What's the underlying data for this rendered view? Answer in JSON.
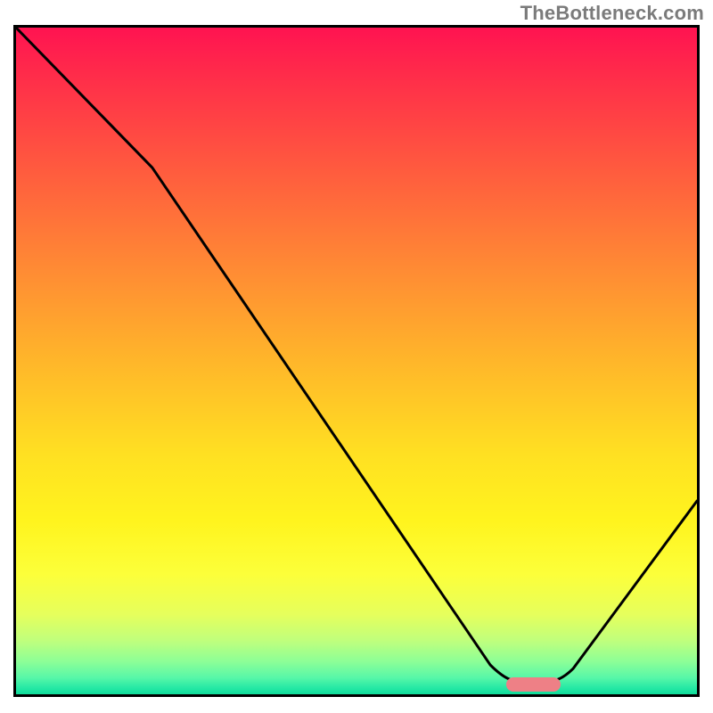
{
  "watermark": "TheBottleneck.com",
  "chart_data": {
    "type": "line",
    "title": "",
    "xlabel": "",
    "ylabel": "",
    "xlim": [
      0,
      100
    ],
    "ylim": [
      0,
      100
    ],
    "grid": false,
    "legend": false,
    "annotations": [],
    "background_gradient": {
      "direction": "vertical",
      "stops": [
        {
          "pos": 0,
          "color": "#ff1351"
        },
        {
          "pos": 50,
          "color": "#ffb62a"
        },
        {
          "pos": 82,
          "color": "#fcff3a"
        },
        {
          "pos": 100,
          "color": "#0fdc9a"
        }
      ]
    },
    "series": [
      {
        "name": "bottleneck-curve",
        "x": [
          0,
          20,
          72,
          80,
          100
        ],
        "y": [
          100,
          79,
          2,
          2,
          29
        ]
      }
    ],
    "marker": {
      "name": "optimal-range",
      "x_start": 72,
      "x_end": 80,
      "y": 1,
      "color": "#ee8086"
    }
  },
  "plot": {
    "inner_w": 764,
    "inner_h": 748
  }
}
